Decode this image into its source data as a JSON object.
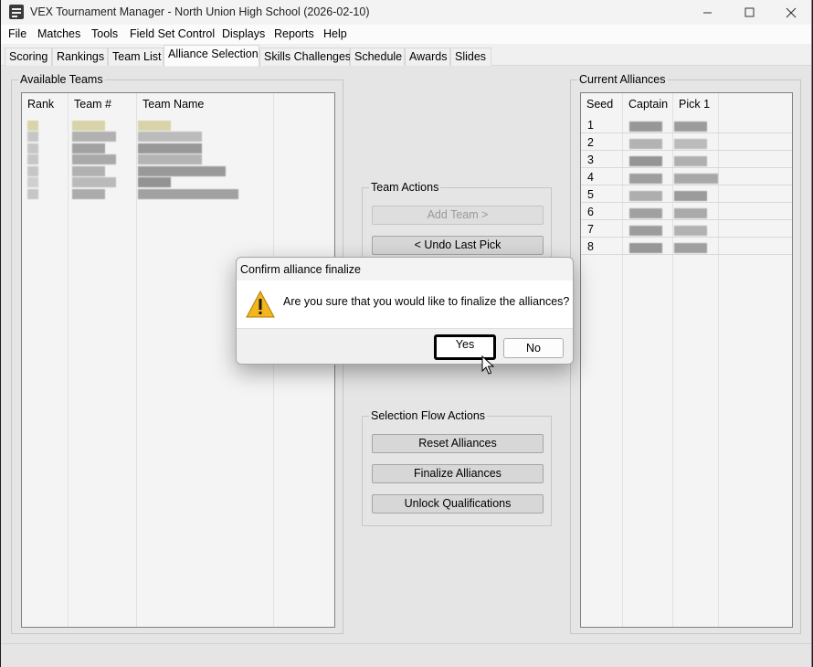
{
  "window": {
    "title": "VEX Tournament Manager - North Union High School (2026-02-10)",
    "controls": [
      "minimize",
      "maximize",
      "close"
    ]
  },
  "menubar": {
    "items": [
      "File",
      "Matches",
      "Tools",
      "Field Set Control",
      "Displays",
      "Reports",
      "Help"
    ]
  },
  "tabs": {
    "items": [
      "Scoring",
      "Rankings",
      "Team List",
      "Alliance Selection",
      "Skills Challenges",
      "Schedule",
      "Awards",
      "Slides"
    ],
    "active": "Alliance Selection"
  },
  "available_teams": {
    "title": "Available Teams",
    "columns": [
      "Rank",
      "Team #",
      "Team Name"
    ]
  },
  "team_actions": {
    "title": "Team Actions",
    "add_team": "Add Team >",
    "undo_last_pick": "< Undo Last Pick"
  },
  "selection_flow": {
    "title": "Selection Flow Actions",
    "reset": "Reset Alliances",
    "finalize": "Finalize Alliances",
    "unlock": "Unlock Qualifications"
  },
  "current_alliances": {
    "title": "Current Alliances",
    "columns": [
      "Seed",
      "Captain",
      "Pick 1"
    ],
    "seeds": [
      "1",
      "2",
      "3",
      "4",
      "5",
      "6",
      "7",
      "8"
    ]
  },
  "dialog": {
    "title": "Confirm alliance finalize",
    "message": "Are you sure that you would like to finalize the alliances?",
    "yes": "Yes",
    "no": "No",
    "icon": "warning-icon"
  }
}
